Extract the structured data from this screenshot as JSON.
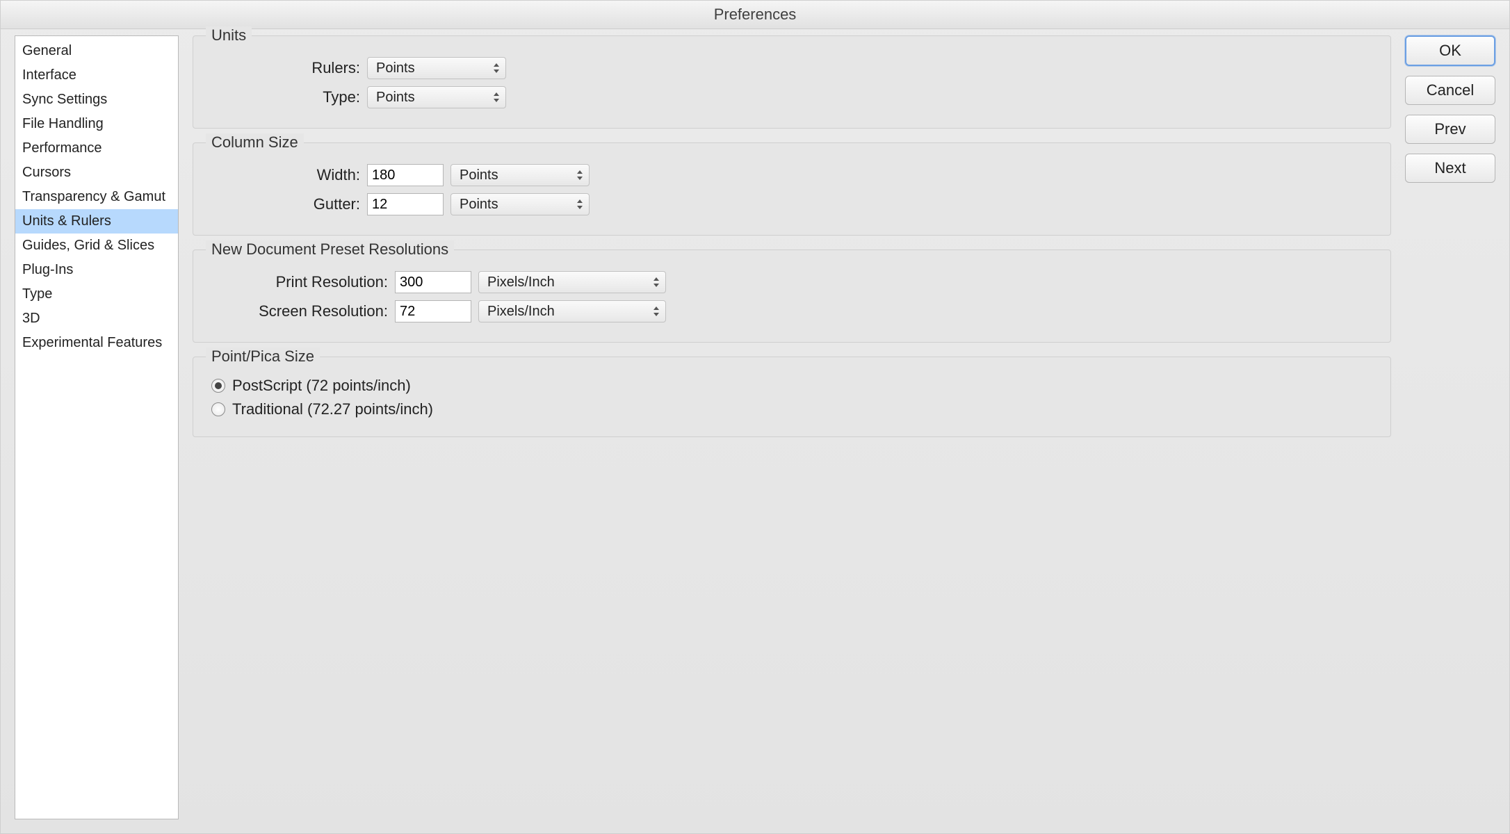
{
  "window": {
    "title": "Preferences"
  },
  "sidebar": {
    "items": [
      "General",
      "Interface",
      "Sync Settings",
      "File Handling",
      "Performance",
      "Cursors",
      "Transparency & Gamut",
      "Units & Rulers",
      "Guides, Grid & Slices",
      "Plug-Ins",
      "Type",
      "3D",
      "Experimental Features"
    ],
    "selected_index": 7
  },
  "groups": {
    "units": {
      "title": "Units",
      "rulers_label": "Rulers:",
      "rulers_value": "Points",
      "type_label": "Type:",
      "type_value": "Points"
    },
    "column_size": {
      "title": "Column Size",
      "width_label": "Width:",
      "width_value": "180",
      "width_unit": "Points",
      "gutter_label": "Gutter:",
      "gutter_value": "12",
      "gutter_unit": "Points"
    },
    "resolutions": {
      "title": "New Document Preset Resolutions",
      "print_label": "Print Resolution:",
      "print_value": "300",
      "print_unit": "Pixels/Inch",
      "screen_label": "Screen Resolution:",
      "screen_value": "72",
      "screen_unit": "Pixels/Inch"
    },
    "point_pica": {
      "title": "Point/Pica Size",
      "postscript_label": "PostScript (72 points/inch)",
      "traditional_label": "Traditional (72.27 points/inch)",
      "selected": "postscript"
    }
  },
  "buttons": {
    "ok": "OK",
    "cancel": "Cancel",
    "prev": "Prev",
    "next": "Next"
  }
}
